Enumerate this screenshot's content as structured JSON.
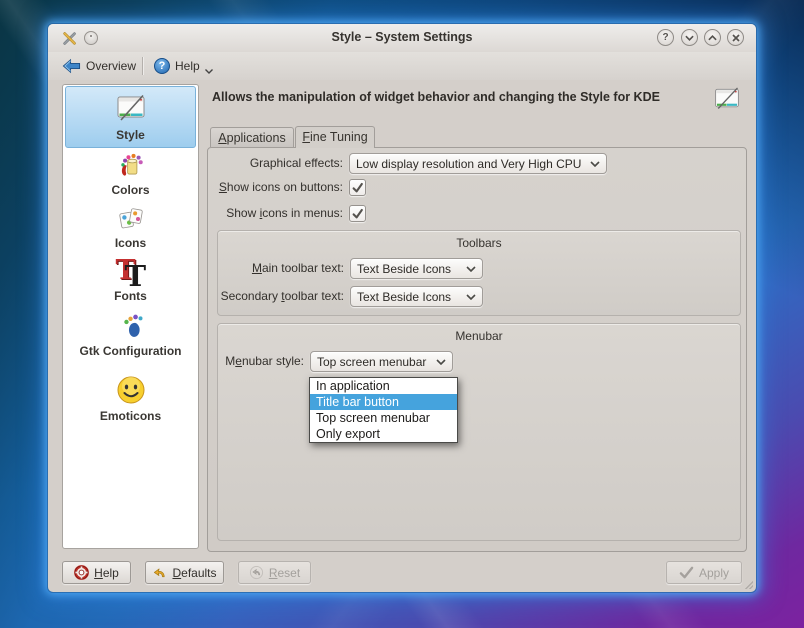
{
  "titlebar": {
    "title": "Style – System Settings",
    "app_icon": "system-settings-crossed-tools",
    "window_buttons": {
      "help_glyph": "?",
      "order": [
        "help",
        "minimize",
        "maximize",
        "close"
      ]
    }
  },
  "toolbar": {
    "overview_label": "Overview",
    "help_label": "Help",
    "help_glyph": "?"
  },
  "sidebar": {
    "items": [
      {
        "label": "Style",
        "icon": "style-window-pencil",
        "selected": true
      },
      {
        "label": "Colors",
        "icon": "paint-can",
        "selected": false
      },
      {
        "label": "Icons",
        "icon": "icon-cards",
        "selected": false
      },
      {
        "label": "Fonts",
        "icon": "letter-t-pair",
        "selected": false
      },
      {
        "label": "Gtk Configuration",
        "icon": "gnome-foot",
        "selected": false
      },
      {
        "label": "Emoticons",
        "icon": "smiley-face",
        "selected": false
      }
    ]
  },
  "main": {
    "header": "Allows the manipulation of widget behavior and changing the Style for KDE",
    "tabs": {
      "applications": {
        "pre": "",
        "accel": "A",
        "post": "pplications",
        "active": false
      },
      "fine_tuning": {
        "pre": "",
        "accel": "F",
        "post": "ine Tuning",
        "active": true
      }
    },
    "form": {
      "graphical_effects": {
        "label": "Graphical effects:",
        "value": "Low display resolution and Very High CPU"
      },
      "icons_on_buttons": {
        "label": {
          "pre": "",
          "accel": "S",
          "post": "how icons on buttons:"
        },
        "checked": true
      },
      "icons_in_menus": {
        "label": {
          "pre": "Show ",
          "accel": "i",
          "post": "cons in menus:"
        },
        "checked": true
      },
      "toolbars_group": {
        "title": "Toolbars",
        "main_toolbar": {
          "label": {
            "pre": "",
            "accel": "M",
            "post": "ain toolbar text:"
          },
          "value": "Text Beside Icons"
        },
        "secondary_toolbar": {
          "label": {
            "pre": "Secondary ",
            "accel": "t",
            "post": "oolbar text:"
          },
          "value": "Text Beside Icons"
        }
      },
      "menubar_group": {
        "title": "Menubar",
        "menubar_style": {
          "label": {
            "pre": "M",
            "accel": "e",
            "post": "nubar style:"
          },
          "value": "Top screen menubar"
        },
        "dropdown": {
          "items": [
            "In application",
            "Title bar button",
            "Top screen menubar",
            "Only export"
          ],
          "highlighted_index": 1
        }
      }
    }
  },
  "footer": {
    "help": {
      "pre": "",
      "accel": "H",
      "post": "elp"
    },
    "defaults": {
      "pre": "",
      "accel": "D",
      "post": "efaults"
    },
    "reset": {
      "pre": "",
      "accel": "R",
      "post": "eset",
      "enabled": false
    },
    "apply_label": "Apply",
    "apply_enabled": false
  },
  "colors": {
    "selection_blue": "#45a3dd",
    "window_glow": "#55a8ec",
    "sidebar_selected_top": "#d3e9f9",
    "sidebar_selected_bottom": "#9ecdee",
    "panel_gray": "#d2cdc8"
  }
}
